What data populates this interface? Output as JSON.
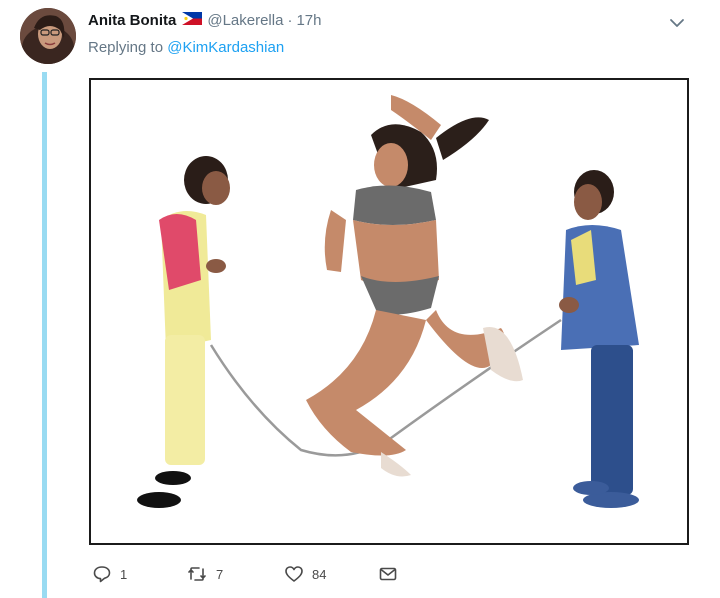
{
  "tweet": {
    "display_name": "Anita Bonita",
    "flag_icon": "philippines-flag-icon",
    "handle": "@Lakerella",
    "separator": "·",
    "time": "17h",
    "reply_prefix": "Replying to",
    "reply_to": "@KimKardashian",
    "media_description_icon": "photo"
  },
  "actions": {
    "reply_count": "1",
    "retweet_count": "7",
    "like_count": "84"
  },
  "colors": {
    "thread_line": "#99dbf2",
    "link": "#1da1f2",
    "secondary_text": "#657786"
  }
}
